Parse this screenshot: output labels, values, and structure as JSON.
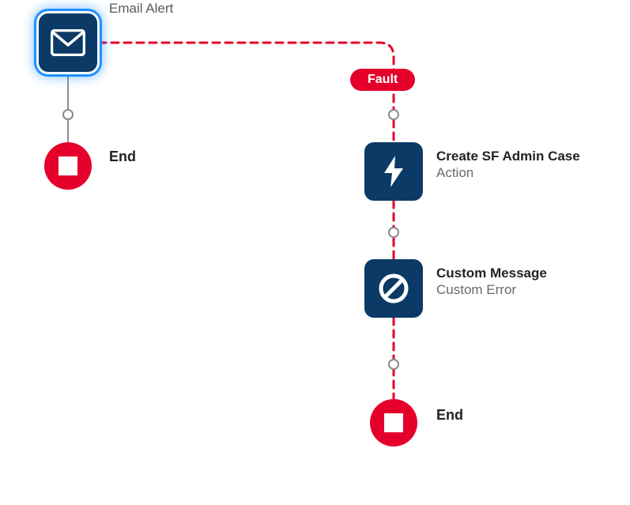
{
  "nodes": {
    "email": {
      "title": "Email Alert"
    },
    "action": {
      "title": "Create SF Admin Case",
      "subtitle": "Action"
    },
    "customError": {
      "title": "Custom Message",
      "subtitle": "Custom Error"
    }
  },
  "endLabel": "End",
  "faultLabel": "Fault",
  "colors": {
    "navy": "#0b3a66",
    "red": "#e4002b",
    "grayLine": "#8f8f8f"
  }
}
